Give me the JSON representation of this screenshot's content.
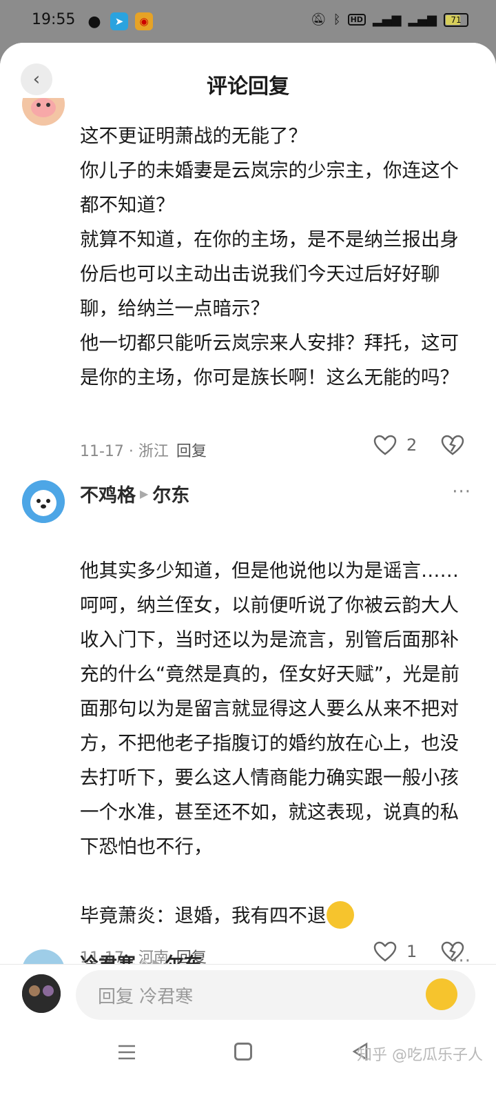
{
  "status_bar": {
    "time": "19:55",
    "battery": "71",
    "battery_level": 0.71
  },
  "header": {
    "title": "评论回复"
  },
  "comments": [
    {
      "text": "这不更证明萧战的无能了？\n你儿子的未婚妻是云岚宗的少宗主，你连这个都不知道？\n就算不知道，在你的主场，是不是纳兰报出身份后也可以主动出击说我们今天过后好好聊聊，给纳兰一点暗示？\n他一切都只能听云岚宗来人安排？拜托，这可是你的主场，你可是族长啊！这么无能的吗？",
      "date": "11-17 · 浙江",
      "reply_label": "回复",
      "likes": "2"
    },
    {
      "author": "不鸡格",
      "reply_to": "尔东",
      "text": "他其实多少知道，但是他说他以为是谣言……呵呵，纳兰侄女，以前便听说了你被云韵大人收入门下，当时还以为是流言，别管后面那补充的什么“竟然是真的，侄女好天赋”，光是前面那句以为是留言就显得这人要么从来不把对方，不把他老子指腹订的婚约放在心上，也没去打听下，要么这人情商能力确实跟一般小孩一个水准，甚至还不如，就这表现，说真的私下恐怕也不行，\n\n毕竟萧炎：退婚，我有四不退",
      "date": "11-17 · 河南",
      "reply_label": "回复",
      "likes": "1"
    },
    {
      "author": "冷君寒",
      "reply_to": "尔东"
    }
  ],
  "input": {
    "placeholder": "回复 冷君寒"
  },
  "watermark": "知乎 @吃瓜乐子人",
  "icons": {
    "back": "chevron-left-icon",
    "like": "heart-outline-icon",
    "dislike": "broken-heart-icon",
    "more": "more-dots-icon",
    "emoji": "emoji-icon"
  }
}
